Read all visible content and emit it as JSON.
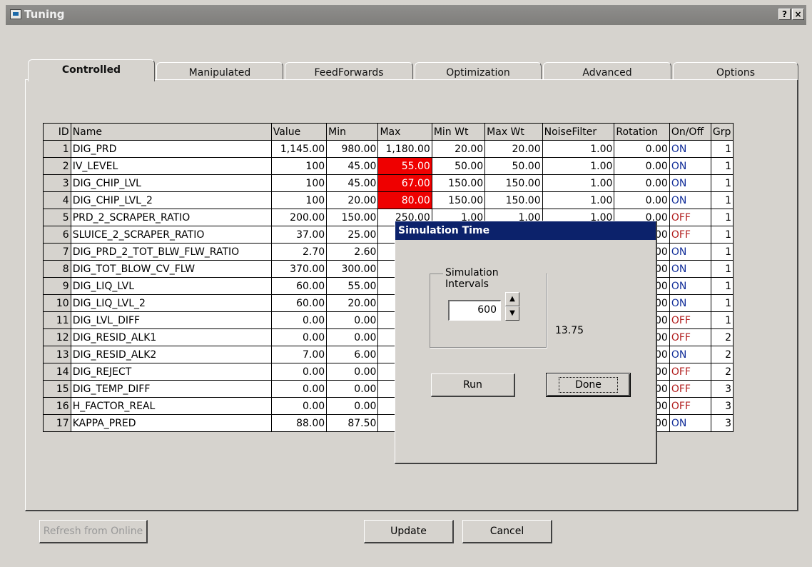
{
  "window": {
    "title": "Tuning",
    "help_button": "?",
    "close_button": "×"
  },
  "tabs": [
    {
      "label": "Controlled"
    },
    {
      "label": "Manipulated"
    },
    {
      "label": "FeedForwards"
    },
    {
      "label": "Optimization"
    },
    {
      "label": "Advanced"
    },
    {
      "label": "Options"
    }
  ],
  "grid": {
    "headers": [
      "ID",
      "Name",
      "Value",
      "Min",
      "Max",
      "Min Wt",
      "Max Wt",
      "NoiseFilter",
      "Rotation",
      "On/Off",
      "Grp"
    ],
    "rows": [
      [
        "1",
        "DIG_PRD",
        "1,145.00",
        "980.00",
        "1,180.00",
        "20.00",
        "20.00",
        "1.00",
        "0.00",
        "ON",
        "1"
      ],
      [
        "2",
        "IV_LEVEL",
        "100",
        "45.00",
        "55.00",
        "50.00",
        "50.00",
        "1.00",
        "0.00",
        "ON",
        "1"
      ],
      [
        "3",
        "DIG_CHIP_LVL",
        "100",
        "45.00",
        "67.00",
        "150.00",
        "150.00",
        "1.00",
        "0.00",
        "ON",
        "1"
      ],
      [
        "4",
        "DIG_CHIP_LVL_2",
        "100",
        "20.00",
        "80.00",
        "150.00",
        "150.00",
        "1.00",
        "0.00",
        "ON",
        "1"
      ],
      [
        "5",
        "PRD_2_SCRAPER_RATIO",
        "200.00",
        "150.00",
        "250.00",
        "1.00",
        "1.00",
        "1.00",
        "0.00",
        "OFF",
        "1"
      ],
      [
        "6",
        "SLUICE_2_SCRAPER_RATIO",
        "37.00",
        "25.00",
        "",
        "",
        "",
        "",
        "0.00",
        "OFF",
        "1"
      ],
      [
        "7",
        "DIG_PRD_2_TOT_BLW_FLW_RATIO",
        "2.70",
        "2.60",
        "",
        "",
        "",
        "",
        "0.00",
        "ON",
        "1"
      ],
      [
        "8",
        "DIG_TOT_BLOW_CV_FLW",
        "370.00",
        "300.00",
        "",
        "",
        "",
        "",
        "0.00",
        "ON",
        "1"
      ],
      [
        "9",
        "DIG_LIQ_LVL",
        "60.00",
        "55.00",
        "",
        "",
        "",
        "",
        "0.00",
        "ON",
        "1"
      ],
      [
        "10",
        "DIG_LIQ_LVL_2",
        "60.00",
        "20.00",
        "",
        "",
        "",
        "",
        "0.00",
        "ON",
        "1"
      ],
      [
        "11",
        "DIG_LVL_DIFF",
        "0.00",
        "0.00",
        "",
        "",
        "",
        "",
        "0.00",
        "OFF",
        "1"
      ],
      [
        "12",
        "DIG_RESID_ALK1",
        "0.00",
        "0.00",
        "",
        "",
        "",
        "",
        "0.00",
        "OFF",
        "2"
      ],
      [
        "13",
        "DIG_RESID_ALK2",
        "7.00",
        "6.00",
        "",
        "",
        "",
        "",
        "0.00",
        "ON",
        "2"
      ],
      [
        "14",
        "DIG_REJECT",
        "0.00",
        "0.00",
        "",
        "",
        "",
        "",
        "0.00",
        "OFF",
        "2"
      ],
      [
        "15",
        "DIG_TEMP_DIFF",
        "0.00",
        "0.00",
        "",
        "",
        "",
        "",
        "0.00",
        "OFF",
        "3"
      ],
      [
        "16",
        "H_FACTOR_REAL",
        "0.00",
        "0.00",
        "",
        "",
        "",
        "",
        "0.00",
        "OFF",
        "3"
      ],
      [
        "17",
        "KAPPA_PRED",
        "88.00",
        "87.50",
        "",
        "",
        "",
        "",
        "0.00",
        "ON",
        "3"
      ]
    ]
  },
  "dialog": {
    "title": "Simulation Time",
    "group_label": "Simulation Intervals",
    "intervals_value": "600",
    "sim_value": "13.75",
    "run_label": "Run",
    "done_label": "Done"
  },
  "buttons": {
    "refresh_label": "Refresh from Online",
    "update_label": "Update",
    "cancel_label": "Cancel"
  },
  "colors": {
    "highlight_red": "#ef0000",
    "on_text": "#14309a",
    "off_text": "#b21f1f",
    "dialog_title_bg": "#0c226b"
  }
}
